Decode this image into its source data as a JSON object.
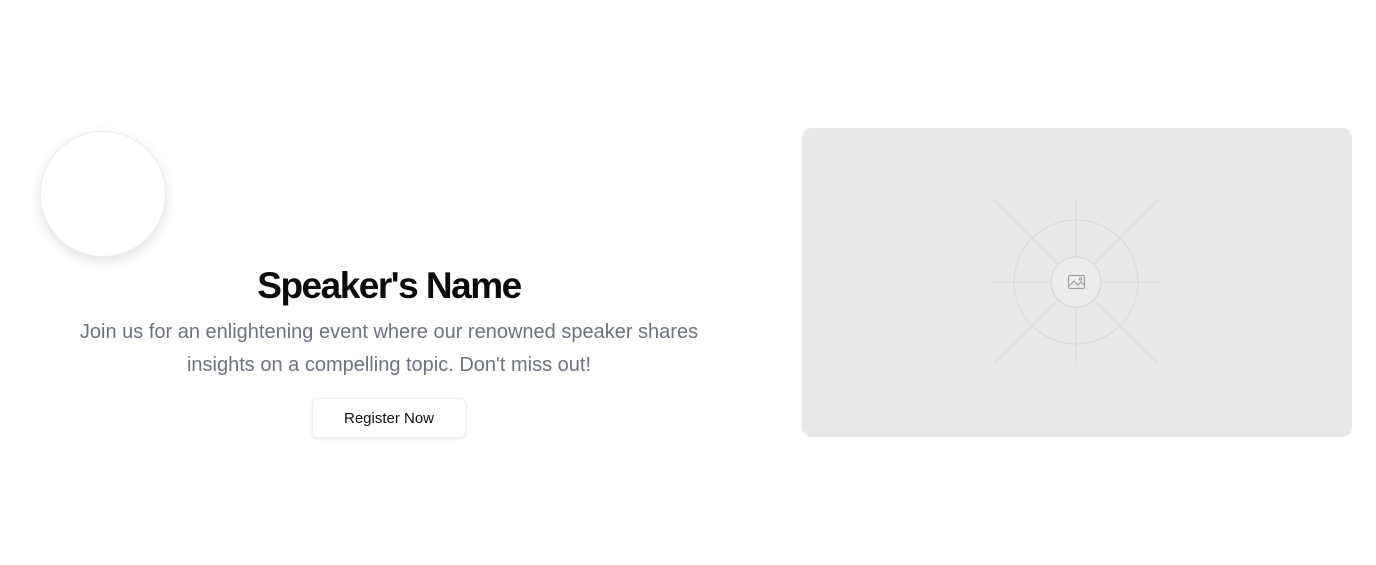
{
  "speaker": {
    "name": "Speaker's Name",
    "description": "Join us for an enlightening event where our renowned speaker shares insights on a compelling topic. Don't miss out!"
  },
  "cta": {
    "label": "Register Now"
  },
  "media": {
    "icon": "image-icon"
  },
  "colors": {
    "background": "#ffffff",
    "heading": "#0a0a0a",
    "body_text": "#6b7280",
    "placeholder_bg": "#e9e9e9"
  }
}
